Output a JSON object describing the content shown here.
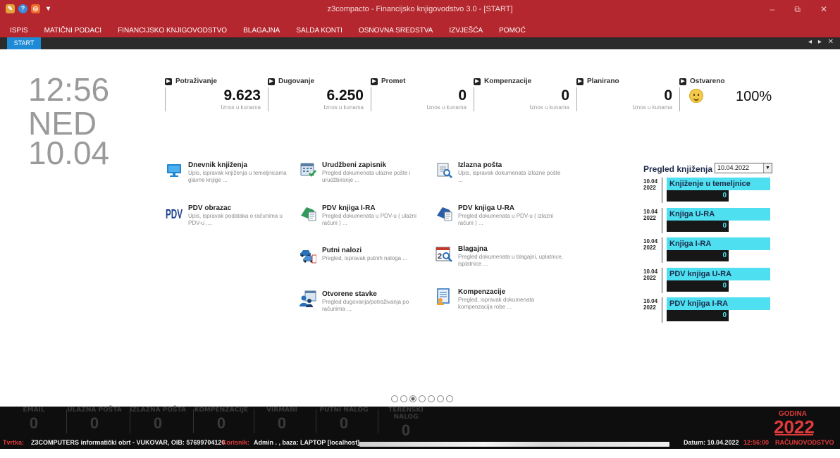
{
  "window": {
    "title": "z3compacto - Financijsko knjigovodstvo 3.0 - [START]",
    "minimize_glyph": "–",
    "restore_glyph": "⧉",
    "close_glyph": "✕",
    "quick_icons": [
      "app-icon",
      "help-icon",
      "office-icon",
      "dropdown-icon"
    ]
  },
  "menu": {
    "items": [
      "ISPIS",
      "MATIČNI PODACI",
      "FINANCIJSKO KNJIGOVODSTVO",
      "BLAGAJNA",
      "SALDA KONTI",
      "OSNOVNA SREDSTVA",
      "IZVJEŠĆA",
      "POMOĆ"
    ]
  },
  "tabs": {
    "active": "START",
    "controls": "◂ ▸ ✕"
  },
  "clock": {
    "time": "12:56",
    "day": "NED",
    "date": "10.04"
  },
  "kpis": [
    {
      "label": "Potraživanje",
      "value": "9.623",
      "unit": "Iznos u kunama"
    },
    {
      "label": "Dugovanje",
      "value": "6.250",
      "unit": "Iznos u kunama"
    },
    {
      "label": "Promet",
      "value": "0",
      "unit": "Iznos u kunama"
    },
    {
      "label": "Kompenzacije",
      "value": "0",
      "unit": "Iznos u kunama"
    },
    {
      "label": "Planirano",
      "value": "0",
      "unit": "Iznos u kunama"
    },
    {
      "label": "Ostvareno",
      "value": "100%"
    }
  ],
  "tiles": [
    {
      "title": "Dnevnik knjiženja",
      "desc": "Upis, ispravak knjiženja u temeljnicama glavne knjige ...",
      "icon": "monitor-icon"
    },
    {
      "title": "Urudžbeni zapisnik",
      "desc": "Pregled dokumenata ulazne pošte i urudžbiranje ...",
      "icon": "calendar-check-icon"
    },
    {
      "title": "Izlazna pošta",
      "desc": "Upis, ispravak dokumenata izlazne pošte ...",
      "icon": "document-search-icon"
    },
    {
      "title": "PDV obrazac",
      "desc": "Upis, ispravak podataka o računima u PDV-u ....",
      "icon": "pdv-logo-icon"
    },
    {
      "title": "PDV knjiga I-RA",
      "desc": "Pregled dokumenata u PDV-u ( ulazni računi ) ...",
      "icon": "book-green-icon"
    },
    {
      "title": "PDV knjiga U-RA",
      "desc": "Pregled dokumenata u PDV-u ( izlazni računi ) ...",
      "icon": "book-blue-icon"
    },
    {
      "title": "Putni nalozi",
      "desc": "Pregled, ispravak putnih naloga ...",
      "icon": "cars-icon"
    },
    {
      "title": "Blagajna",
      "desc": "Pregled dokumenata u blagajni, uplatnice, isplatnice ...",
      "icon": "calendar-search-icon"
    },
    {
      "title": "Otvorene stavke",
      "desc": "Pregled dugovanja/potraživanja po računima ...",
      "icon": "people-calendar-icon"
    },
    {
      "title": "Kompenzacije",
      "desc": "Pregled, ispravak dokumenata kompenzacija robe ...",
      "icon": "form-user-icon"
    }
  ],
  "pregled": {
    "title": "Pregled knjiženja",
    "selected_date": "10.04.2022",
    "rows": [
      {
        "day": "10.04",
        "year": "2022",
        "label": "Knjiženje u temeljnice",
        "value": "0"
      },
      {
        "day": "10.04",
        "year": "2022",
        "label": "Knjiga U-RA",
        "value": "0"
      },
      {
        "day": "10.04",
        "year": "2022",
        "label": "Knjiga I-RA",
        "value": "0"
      },
      {
        "day": "10.04",
        "year": "2022",
        "label": "PDV knjiga U-RA",
        "value": "0"
      },
      {
        "day": "10.04",
        "year": "2022",
        "label": "PDV knjiga I-RA",
        "value": "0"
      }
    ]
  },
  "pager": {
    "count": 7,
    "active": 2
  },
  "counters": [
    {
      "label": "EMAIL",
      "value": "0"
    },
    {
      "label": "ULAZNA POŠTA",
      "value": "0"
    },
    {
      "label": "IZLAZNA POŠTA",
      "value": "0"
    },
    {
      "label": "KOMPENZACIJE",
      "value": "0"
    },
    {
      "label": "VIRMANI",
      "value": "0"
    },
    {
      "label": "PUTNI NALOG",
      "value": "0"
    },
    {
      "label": "TERENSKI NALOG",
      "value": "0"
    }
  ],
  "godina": {
    "label": "GODINA",
    "value": "2022"
  },
  "status": {
    "firma_label": "Tvrtka:",
    "firma_value": "Z3COMPUTERS informatički obrt - VUKOVAR, OIB: 57699704120",
    "korisnik_label": "Korisnik:",
    "korisnik_value": "Admin . , baza: LAPTOP [localhost]",
    "datum": "Datum: 10.04.2022",
    "time": "12:56:00",
    "mode": "RAČUNOVODSTVO"
  },
  "colors": {
    "accent": "#b5272e",
    "tab": "#1d8ad6",
    "cyan": "#4ee0f0",
    "status_red": "#e03a3a"
  }
}
